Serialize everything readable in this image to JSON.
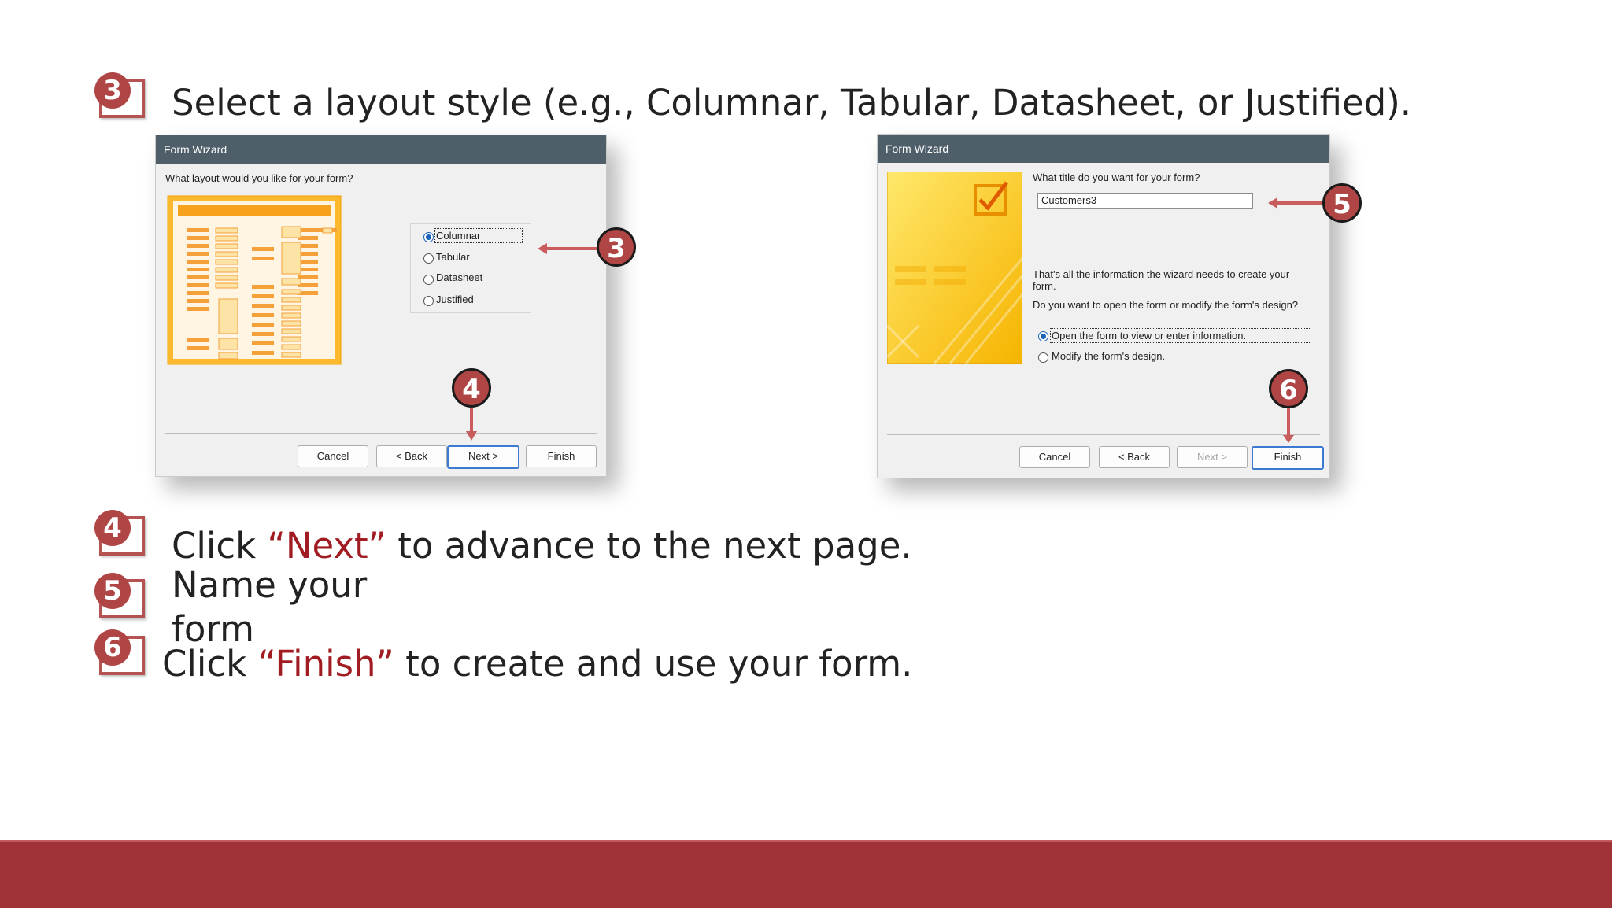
{
  "steps": {
    "s3": {
      "num": "3",
      "text": "Select a layout style (e.g., Columnar, Tabular, Datasheet, or Justified)."
    },
    "s4": {
      "num": "4",
      "pre": "Click ",
      "highlight": "“Next”",
      "post": " to advance to the next page."
    },
    "s5": {
      "num": "5",
      "line1": "Name your",
      "line2": "form"
    },
    "s6": {
      "num": "6",
      "pre": "Click ",
      "highlight": "“Finish”",
      "post": " to create and use your form."
    }
  },
  "dialog_left": {
    "title": "Form Wizard",
    "question": "What layout would you like for your form?",
    "options": [
      "Columnar",
      "Tabular",
      "Datasheet",
      "Justified"
    ],
    "selected_option": "Columnar",
    "buttons": {
      "cancel": "Cancel",
      "back": "< Back",
      "next": "Next >",
      "finish": "Finish"
    }
  },
  "dialog_right": {
    "title": "Form Wizard",
    "question": "What title do you want for your form?",
    "title_value": "Customers3",
    "info1": "That's all the information the wizard needs to create your",
    "info1b": "form.",
    "info2": "Do you want to open the form or modify the form's design?",
    "options": [
      "Open the form to view or enter information.",
      "Modify the form's design."
    ],
    "selected_option": "Open the form to view or enter information.",
    "buttons": {
      "cancel": "Cancel",
      "back": "< Back",
      "next": "Next >",
      "finish": "Finish"
    }
  },
  "callouts": {
    "c3": "3",
    "c4": "4",
    "c5": "5",
    "c6": "6"
  },
  "colors": {
    "accent": "#a01c22",
    "bottom_bar": "#a03338",
    "badge": "#b04545"
  }
}
